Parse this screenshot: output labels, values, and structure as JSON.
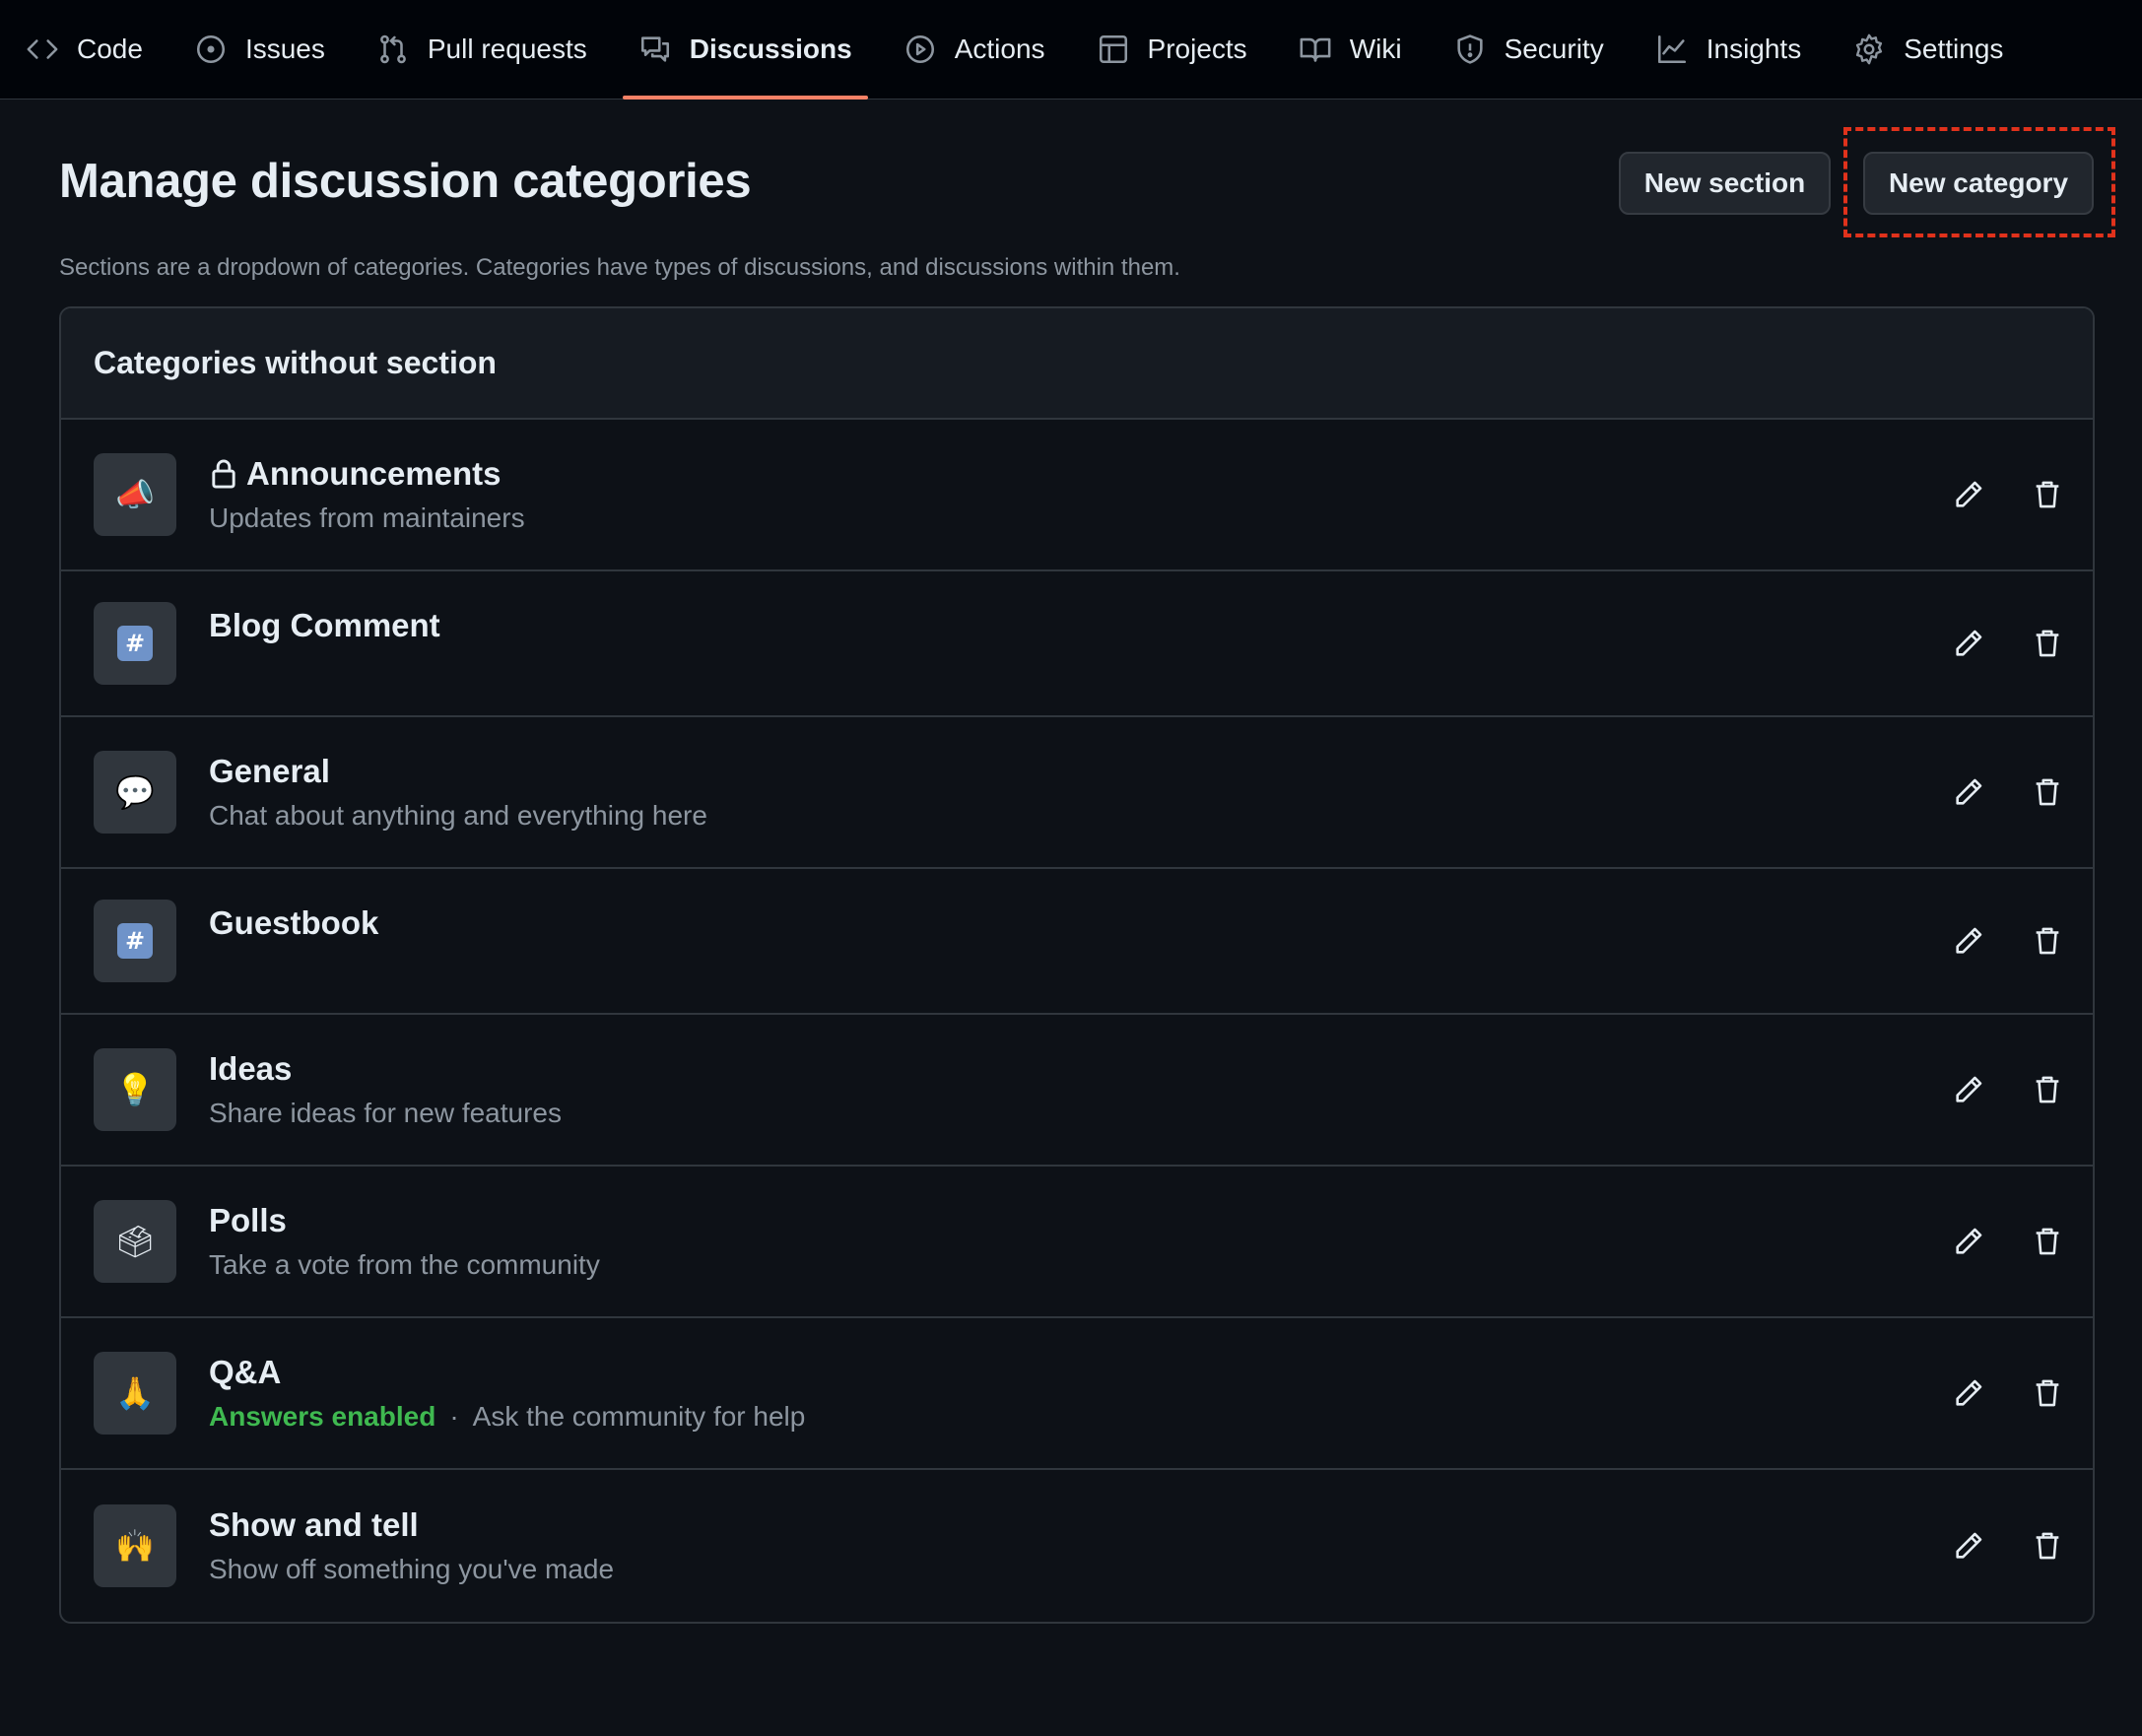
{
  "nav": {
    "tabs": [
      {
        "label": "Code",
        "icon": "code-icon"
      },
      {
        "label": "Issues",
        "icon": "issue-icon"
      },
      {
        "label": "Pull requests",
        "icon": "pull-request-icon"
      },
      {
        "label": "Discussions",
        "icon": "discussion-icon",
        "selected": true
      },
      {
        "label": "Actions",
        "icon": "play-icon"
      },
      {
        "label": "Projects",
        "icon": "table-icon"
      },
      {
        "label": "Wiki",
        "icon": "book-icon"
      },
      {
        "label": "Security",
        "icon": "shield-icon"
      },
      {
        "label": "Insights",
        "icon": "graph-icon"
      },
      {
        "label": "Settings",
        "icon": "gear-icon"
      }
    ]
  },
  "header": {
    "title": "Manage discussion categories",
    "description": "Sections are a dropdown of categories. Categories have types of discussions, and discussions within them.",
    "new_section_label": "New section",
    "new_category_label": "New category"
  },
  "box": {
    "title": "Categories without section",
    "categories": [
      {
        "name": "Announcements",
        "description": "Updates from maintainers",
        "emoji": "📣",
        "locked": true
      },
      {
        "name": "Blog Comment",
        "description": "",
        "emoji": "#"
      },
      {
        "name": "General",
        "description": "Chat about anything and everything here",
        "emoji": "💬"
      },
      {
        "name": "Guestbook",
        "description": "",
        "emoji": "#"
      },
      {
        "name": "Ideas",
        "description": "Share ideas for new features",
        "emoji": "💡"
      },
      {
        "name": "Polls",
        "description": "Take a vote from the community",
        "emoji": "🗳"
      },
      {
        "name": "Q&A",
        "answers_label": "Answers enabled",
        "separator": "·",
        "description": "Ask the community for help",
        "emoji": "🙏"
      },
      {
        "name": "Show and tell",
        "description": "Show off something you've made",
        "emoji": "🙌"
      }
    ]
  },
  "colors": {
    "background": "#0d1117",
    "nav_background": "#010409",
    "accent_underline": "#f78166",
    "answers_green": "#3fb950",
    "highlight_red": "#e0321c"
  }
}
